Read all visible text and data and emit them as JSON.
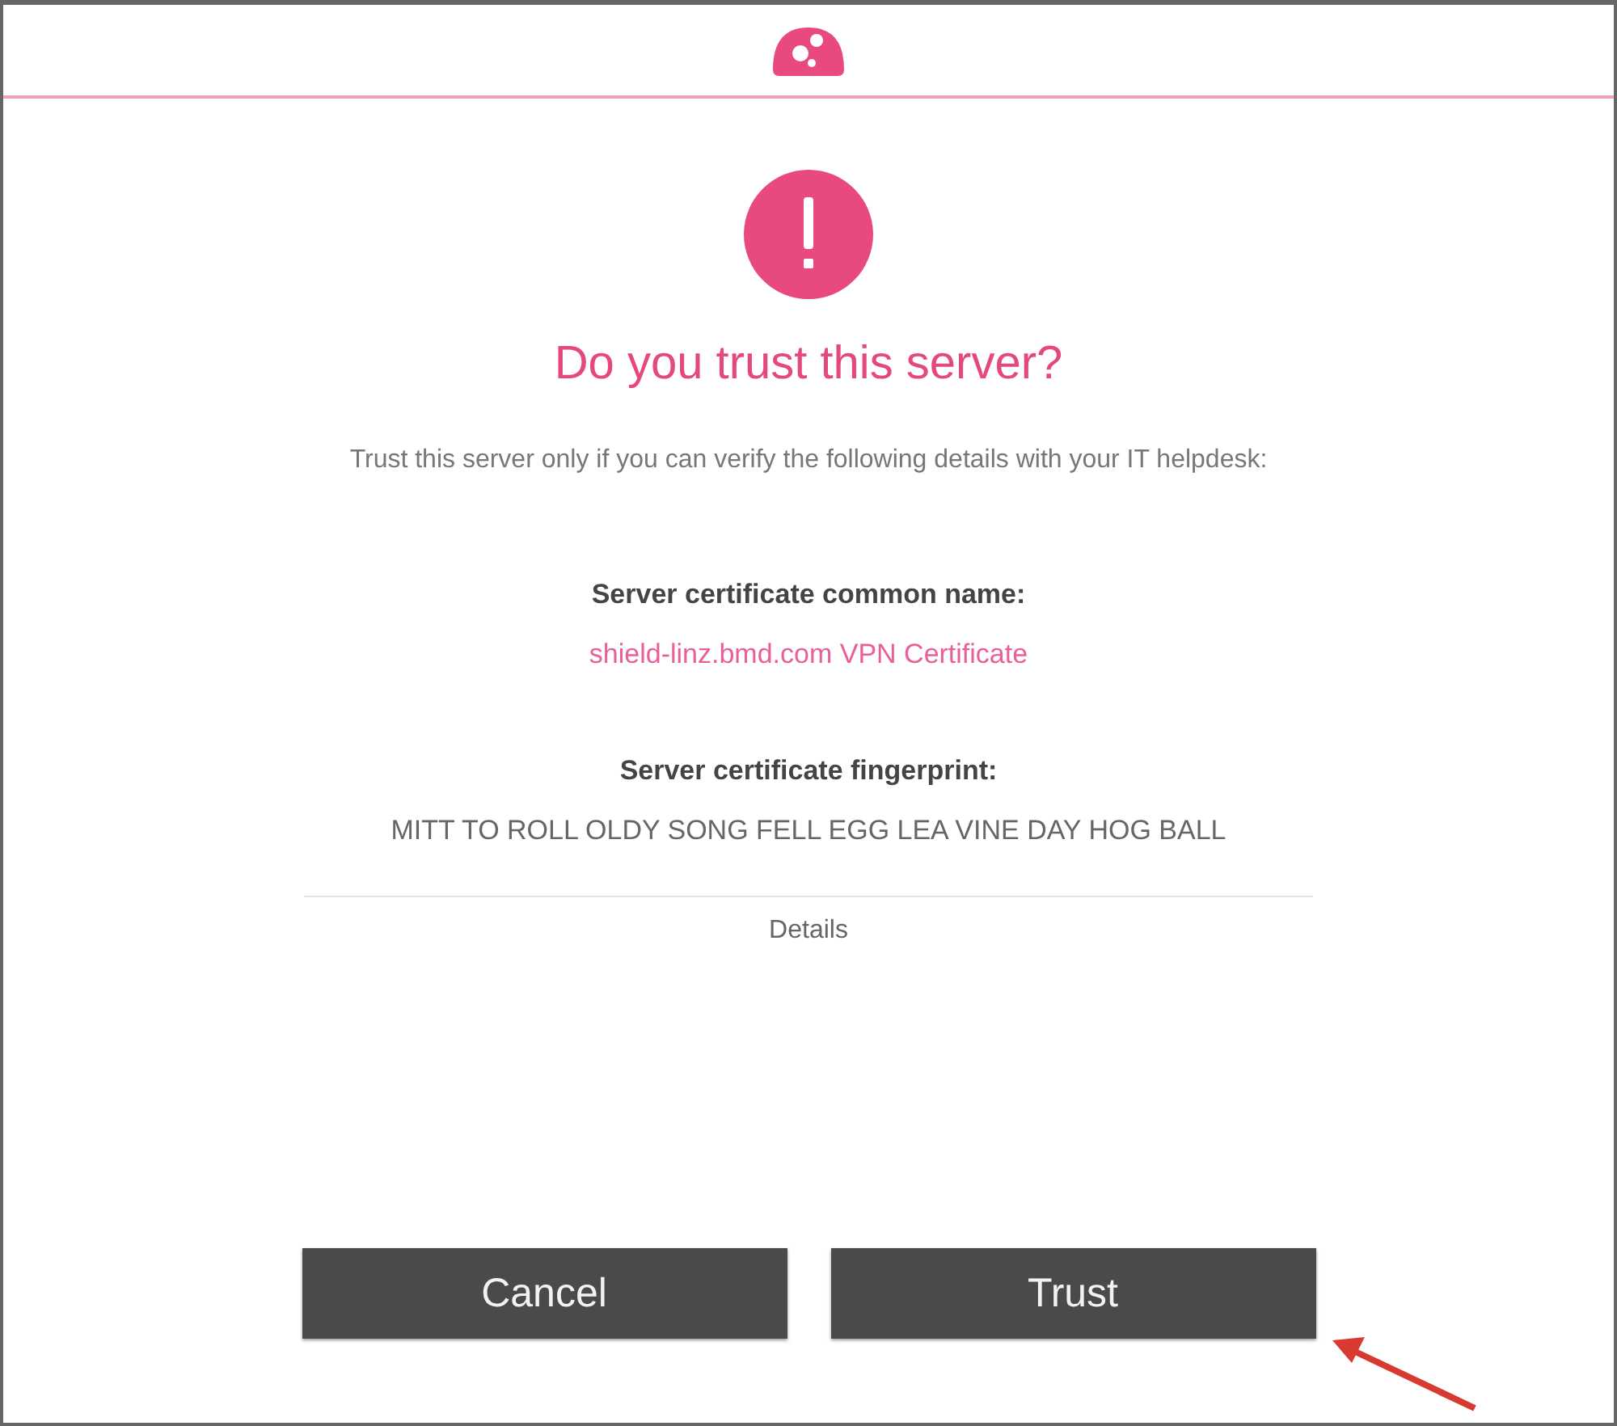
{
  "dialog": {
    "title": "Do you trust this server?",
    "message": "Trust this server only if you can verify the following details with your IT helpdesk:",
    "fields": [
      {
        "label": "Server certificate common name:",
        "value": "shield-linz.bmd.com VPN Certificate",
        "kind": "link"
      },
      {
        "label": "Server certificate fingerprint:",
        "value": "MITT TO ROLL OLDY SONG FELL EGG LEA VINE DAY HOG BALL",
        "kind": "plain"
      }
    ],
    "details_link": "Details",
    "buttons": [
      "Cancel",
      "Trust"
    ]
  },
  "annotation": {
    "kind": "arrow"
  }
}
